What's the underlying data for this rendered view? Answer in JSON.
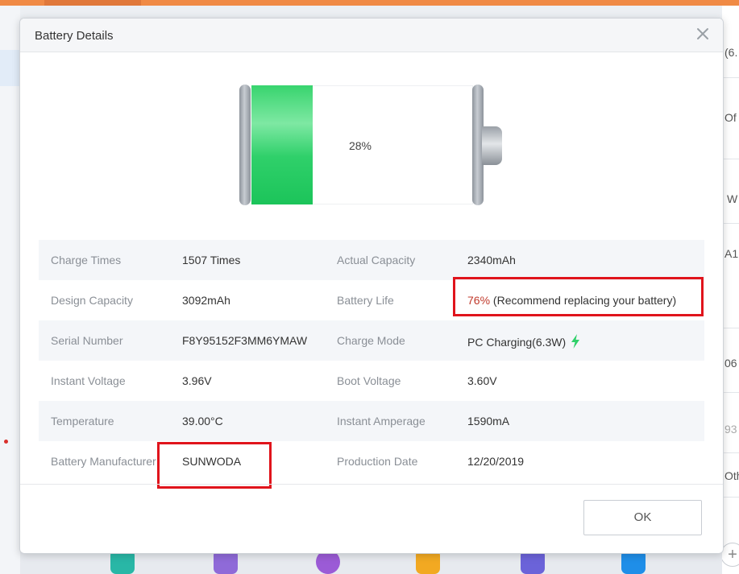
{
  "background": {
    "right_fragments": [
      "(6.",
      "Of",
      "W",
      "A1",
      "06",
      "93",
      "Oth"
    ],
    "plus_label": "+"
  },
  "dialog": {
    "title": "Battery Details",
    "battery": {
      "level_percent": 28,
      "label": "28%",
      "fill_color": "#2fd06a"
    },
    "rows": [
      {
        "label1": "Charge Times",
        "value1": "1507 Times",
        "label2": "Actual Capacity",
        "value2": "2340mAh"
      },
      {
        "label1": "Design Capacity",
        "value1": "3092mAh",
        "label2": "Battery Life",
        "value2_pct": "76%",
        "value2_note": "(Recommend replacing your battery)"
      },
      {
        "label1": "Serial Number",
        "value1": "F8Y95152F3MM6YMAW",
        "label2": "Charge Mode",
        "value2": "PC Charging(6.3W)",
        "icon": "lightning-bolt-icon"
      },
      {
        "label1": "Instant Voltage",
        "value1": "3.96V",
        "label2": "Boot Voltage",
        "value2": "3.60V"
      },
      {
        "label1": "Temperature",
        "value1": "39.00°C",
        "label2": "Instant Amperage",
        "value2": "1590mA"
      },
      {
        "label1": "Battery Manufacturer",
        "value1": "SUNWODA",
        "label2": "Production Date",
        "value2": "12/20/2019"
      }
    ],
    "ok_label": "OK"
  },
  "colors": {
    "accent_green": "#2fd06a",
    "warning_red": "#c0392b",
    "annotation_red": "#e0141c"
  }
}
